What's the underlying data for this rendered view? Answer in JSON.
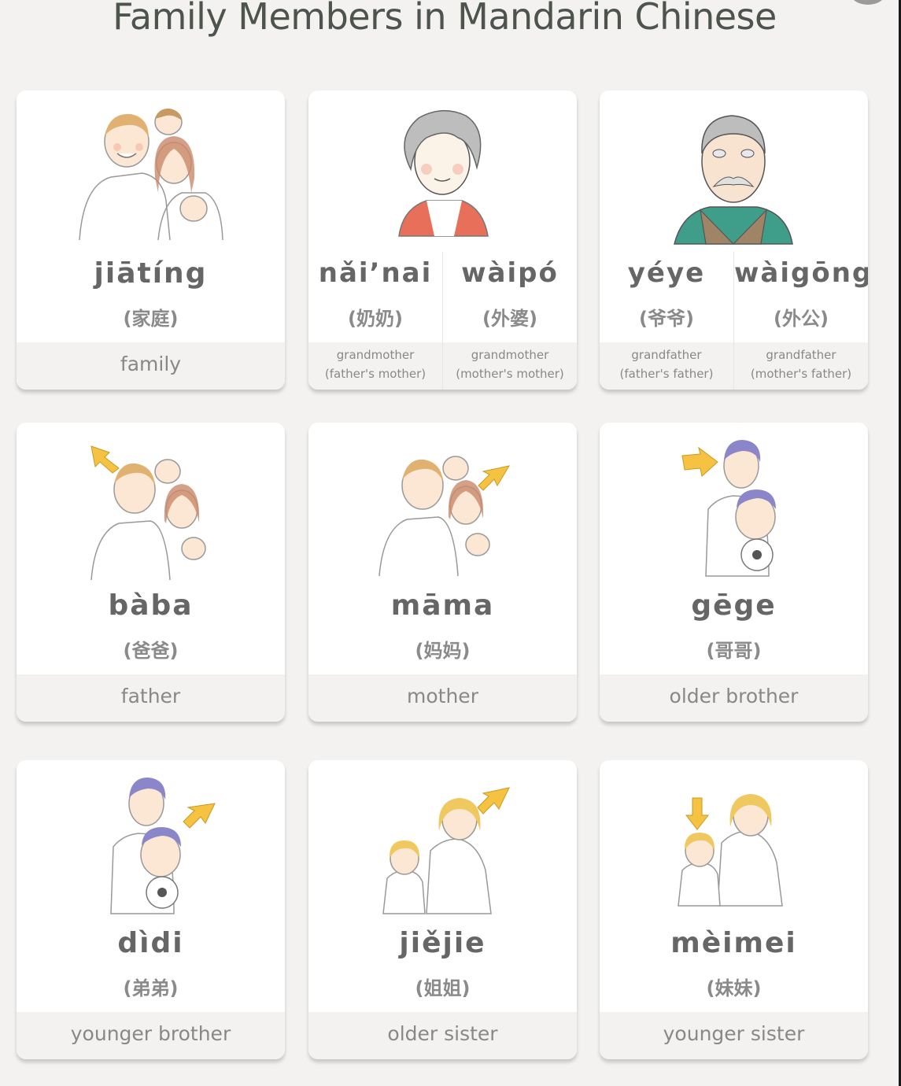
{
  "page": {
    "title": "Family Members in Mandarin Chinese"
  },
  "cards": [
    {
      "pinyin": "jiātíng",
      "hanzi": "(家庭)",
      "meaning": "family",
      "illustration": "family-illustration"
    },
    {
      "split": [
        {
          "pinyin": "nǎi’nai",
          "hanzi": "(奶奶)",
          "meaning_line1": "grandmother",
          "meaning_line2": "(father's mother)"
        },
        {
          "pinyin": "wàipó",
          "hanzi": "(外婆)",
          "meaning_line1": "grandmother",
          "meaning_line2": "(mother's mother)"
        }
      ],
      "illustration": "grandmother-illustration"
    },
    {
      "split": [
        {
          "pinyin": "yéye",
          "hanzi": "(爷爷)",
          "meaning_line1": "grandfather",
          "meaning_line2": "(father's father)"
        },
        {
          "pinyin": "wàigōng",
          "hanzi": "(外公)",
          "meaning_line1": "grandfather",
          "meaning_line2": "(mother's father)"
        }
      ],
      "illustration": "grandfather-illustration"
    },
    {
      "pinyin": "bàba",
      "hanzi": "(爸爸)",
      "meaning": "father",
      "illustration": "family-arrow-father-illustration"
    },
    {
      "pinyin": "māma",
      "hanzi": "(妈妈)",
      "meaning": "mother",
      "illustration": "family-arrow-mother-illustration"
    },
    {
      "pinyin": "gēge",
      "hanzi": "(哥哥)",
      "meaning": "older brother",
      "illustration": "brothers-arrow-older-illustration"
    },
    {
      "pinyin": "dìdi",
      "hanzi": "(弟弟)",
      "meaning": "younger brother",
      "illustration": "brothers-arrow-younger-illustration"
    },
    {
      "pinyin": "jiějie",
      "hanzi": "(姐姐)",
      "meaning": "older sister",
      "illustration": "sisters-arrow-older-illustration"
    },
    {
      "pinyin": "mèimei",
      "hanzi": "(妹妹)",
      "meaning": "younger sister",
      "illustration": "sisters-arrow-younger-illustration"
    }
  ],
  "colors": {
    "background": "#f3f2f0",
    "title": "#4d544e",
    "arrow": "#f5c242",
    "grandma_scarf": "#e8705a",
    "grandpa_sweater": "#3f9e8a",
    "grandpa_vest": "#a08466",
    "boy_hair": "#8b86c9",
    "girl_hair": "#f0c860"
  }
}
